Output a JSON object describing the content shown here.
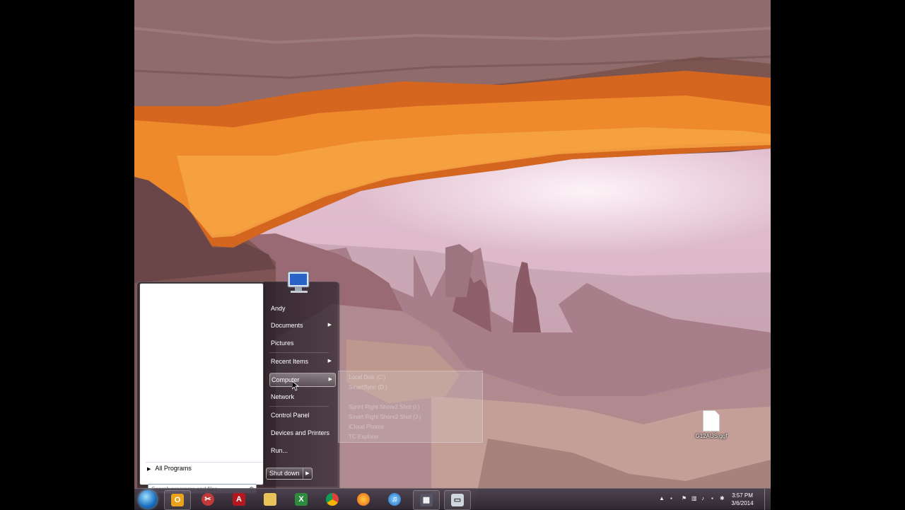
{
  "start_menu": {
    "items": [
      {
        "label": "Andy",
        "has_submenu": false
      },
      {
        "label": "Documents",
        "has_submenu": true
      },
      {
        "label": "Pictures",
        "has_submenu": false
      },
      {
        "label": "Recent Items",
        "has_submenu": true
      },
      {
        "label": "Computer",
        "has_submenu": true,
        "hovered": true
      },
      {
        "label": "Network",
        "has_submenu": false
      },
      {
        "label": "Control Panel",
        "has_submenu": false
      },
      {
        "label": "Devices and Printers",
        "has_submenu": false
      },
      {
        "label": "Run...",
        "has_submenu": false
      }
    ],
    "all_programs": "All Programs",
    "search_placeholder": "Search programs and files",
    "shutdown_label": "Shut down"
  },
  "computer_submenu": {
    "items": [
      "Local Disk (C:)",
      "SmartSync (D:)",
      "Sprint Right Shore2 Shot (I:)",
      "Smart Right Shore2 Shot (J:)",
      "iCloud Photos",
      "TC Explorer"
    ]
  },
  "taskbar": {
    "icons": [
      "start-orb",
      "outlook-icon",
      "snipping-tool-icon",
      "acrobat-icon",
      "explorer-folder-icon",
      "excel-icon",
      "chrome-icon",
      "firefox-icon",
      "itunes-icon",
      "media-icon",
      "remote-desktop-icon"
    ],
    "clock_time": "3:57 PM",
    "clock_date": "3/6/2014"
  },
  "desktop": {
    "file_name": "G12AUS.ggf"
  },
  "colors": {
    "taskbar": "#2e2832",
    "start_orb": "#1a6fc1",
    "selection": "#ffffff"
  }
}
